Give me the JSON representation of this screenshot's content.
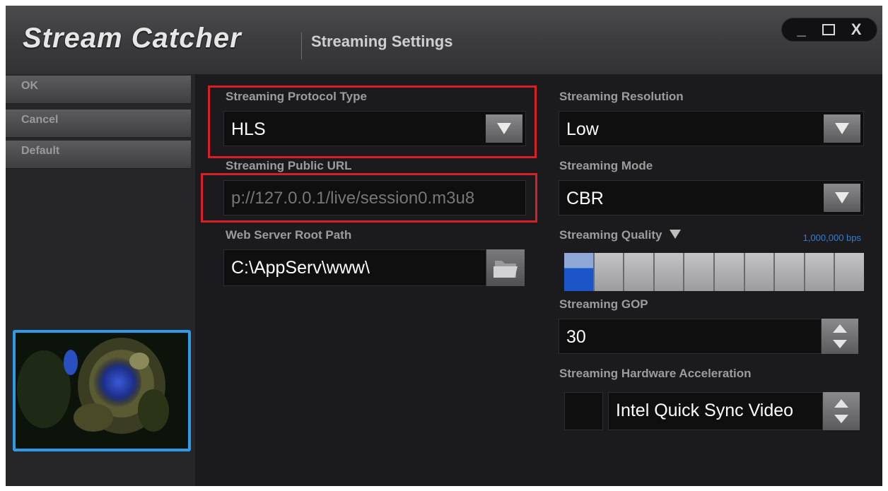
{
  "app": {
    "title": "Stream Catcher",
    "section": "Streaming Settings"
  },
  "window_controls": {
    "minimize": "_",
    "close": "X"
  },
  "sidebar": {
    "buttons": [
      {
        "label": "OK"
      },
      {
        "label": "Cancel"
      },
      {
        "label": "Default"
      }
    ]
  },
  "protocol": {
    "label": "Streaming Protocol Type",
    "value": "HLS"
  },
  "public_url": {
    "label": "Streaming Public URL",
    "value": "p://127.0.0.1/live/session0.m3u8"
  },
  "web_root": {
    "label": "Web Server Root Path",
    "value": "C:\\AppServ\\www\\"
  },
  "resolution": {
    "label": "Streaming Resolution",
    "value": "Low"
  },
  "mode": {
    "label": "Streaming Mode",
    "value": "CBR"
  },
  "quality": {
    "label": "Streaming Quality",
    "bitrate": "1,000,000 bps",
    "level": 1,
    "segments": 10
  },
  "gop": {
    "label": "Streaming GOP",
    "value": "30"
  },
  "hw_accel": {
    "label": "Streaming Hardware Acceleration",
    "value": "Intel Quick Sync Video",
    "checked": false
  },
  "colors": {
    "highlight": "#d61f26",
    "accent": "#2e9be8",
    "quality_fill": "#1b55c8"
  },
  "icons": [
    "dropdown-arrow-icon",
    "folder-open-icon",
    "spinner-arrows-icon",
    "quality-arrow-icon"
  ]
}
